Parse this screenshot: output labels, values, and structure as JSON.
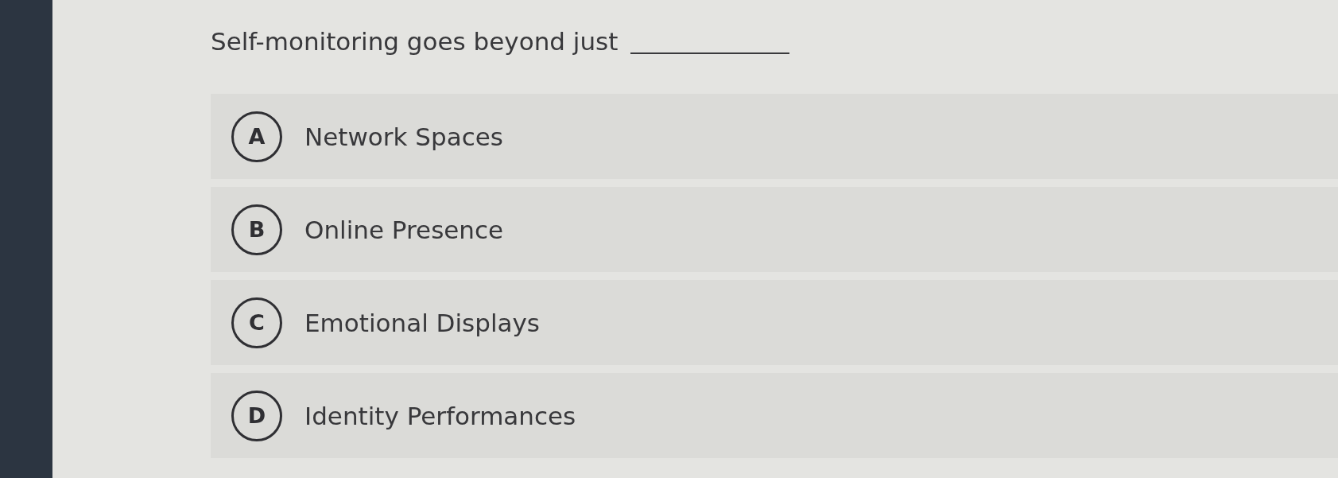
{
  "question": {
    "text": "Self-monitoring goes beyond just",
    "blank": true
  },
  "options": [
    {
      "letter": "A",
      "text": "Network Spaces",
      "selected": false
    },
    {
      "letter": "B",
      "text": "Online Presence",
      "selected": false
    },
    {
      "letter": "C",
      "text": "Emotional Displays",
      "selected": false
    },
    {
      "letter": "D",
      "text": "Identity Performances",
      "selected": false
    }
  ]
}
